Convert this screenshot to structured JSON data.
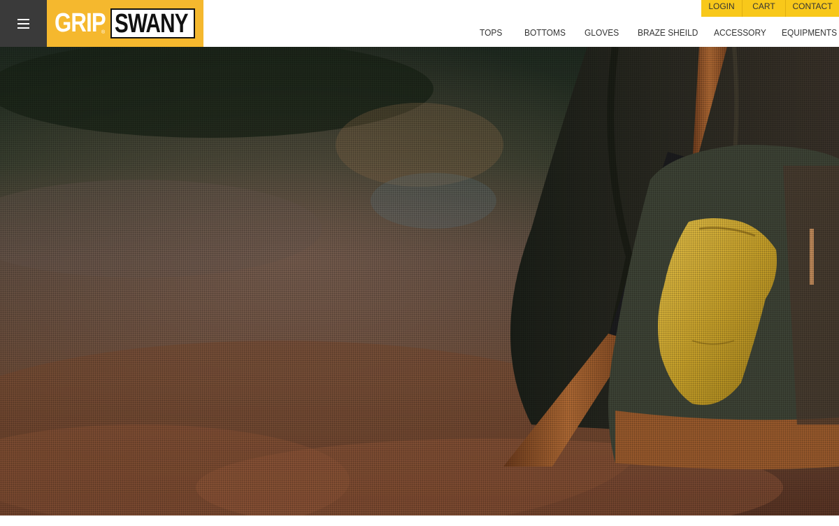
{
  "header": {
    "menu_icon": "hamburger-menu-icon",
    "brand": {
      "part1": "GRIP",
      "registered": "®",
      "part2": "SWANY"
    },
    "utility_nav": [
      {
        "label": "LOGIN"
      },
      {
        "label": "CART"
      },
      {
        "label": "CONTACT"
      }
    ],
    "main_nav": [
      {
        "label": "TOPS"
      },
      {
        "label": "BOTTOMS"
      },
      {
        "label": "GLOVES"
      },
      {
        "label": "BRAZE SHEILD"
      },
      {
        "label": "ACCESSORY"
      },
      {
        "label": "EQUIPMENTS"
      }
    ]
  },
  "colors": {
    "brand_yellow": "#f5b82e",
    "utility_yellow": "#f8c81a",
    "menu_dark": "#3a3a3a",
    "nav_text": "#333333"
  }
}
